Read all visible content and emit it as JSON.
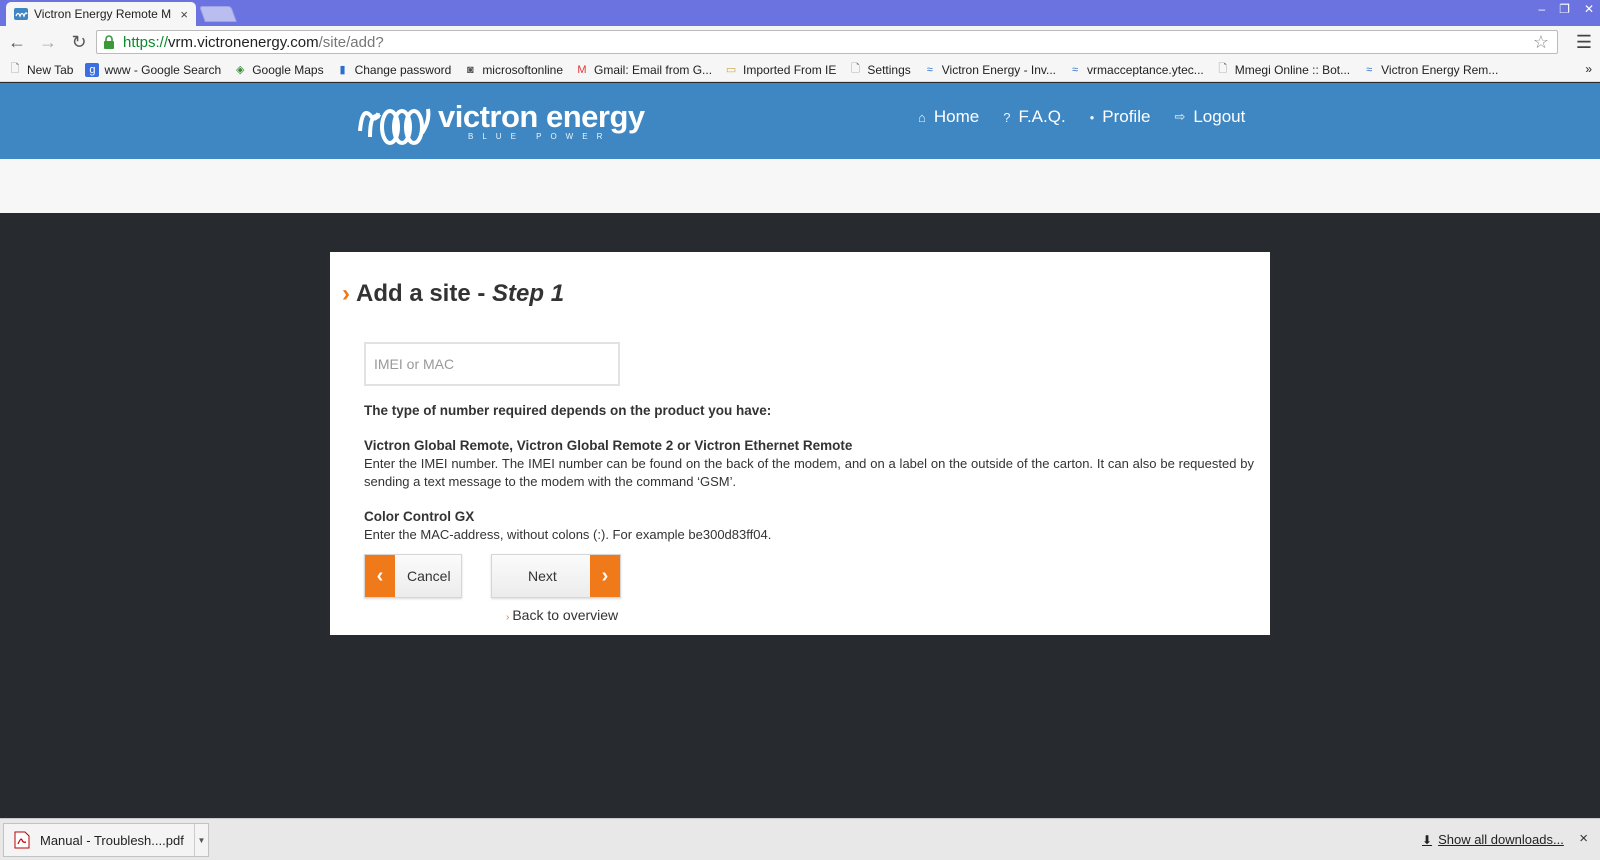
{
  "browser": {
    "tab_title": "Victron Energy Remote M",
    "tab_close": "×",
    "window_controls": [
      "–",
      "❐",
      "✕"
    ],
    "url": {
      "scheme": "https://",
      "host": "vrm.victronenergy.com",
      "path": "/site/add?"
    },
    "bookmarks": [
      {
        "label": "New Tab",
        "icon": "page-icon"
      },
      {
        "label": "www - Google Search",
        "icon": "google-icon"
      },
      {
        "label": "Google Maps",
        "icon": "maps-icon"
      },
      {
        "label": "Change password",
        "icon": "office-icon"
      },
      {
        "label": "microsoftonline",
        "icon": "user-icon"
      },
      {
        "label": "Gmail: Email from G...",
        "icon": "gmail-icon"
      },
      {
        "label": "Imported From IE",
        "icon": "folder-icon"
      },
      {
        "label": "Settings",
        "icon": "page-icon"
      },
      {
        "label": "Victron Energy - Inv...",
        "icon": "victron-icon"
      },
      {
        "label": "vrmacceptance.ytec...",
        "icon": "victron-icon"
      },
      {
        "label": "Mmegi Online :: Bot...",
        "icon": "page-icon"
      },
      {
        "label": "Victron Energy Rem...",
        "icon": "victron-icon"
      }
    ],
    "bookmarks_more": "»"
  },
  "site": {
    "logo_name": "victron energy",
    "logo_sub": "BLUE POWER",
    "nav": {
      "home": "Home",
      "faq": "F.A.Q.",
      "profile": "Profile",
      "logout": "Logout"
    },
    "nav_icons": [
      "home-icon",
      "question-icon",
      "user-icon",
      "logout-icon"
    ]
  },
  "form": {
    "title_main": "Add a site - ",
    "title_step": "Step 1",
    "imei_placeholder": "IMEI or MAC",
    "imei_value": "",
    "intro": "The type of number required depends on the product you have:",
    "remote_heading": "Victron Global Remote, Victron Global Remote 2 or Victron Ethernet Remote",
    "remote_desc": "Enter the IMEI number. The IMEI number can be found on the back of the modem, and on a label on the outside of the carton. It can also be requested by sending a text message to the modem with the command ‘GSM’.",
    "gx_heading": "Color Control GX",
    "gx_desc": "Enter the MAC-address, without colons (:). For example be300d83ff04.",
    "cancel_label": "Cancel",
    "next_label": "Next",
    "back_label": "Back to overview"
  },
  "downloads": {
    "file_name": "Manual - Troublesh....pdf",
    "show_all": "Show all downloads...",
    "close": "×"
  },
  "colors": {
    "header_blue": "#3e87c2",
    "accent_orange": "#f07a1a",
    "page_dark": "#272b2f"
  }
}
